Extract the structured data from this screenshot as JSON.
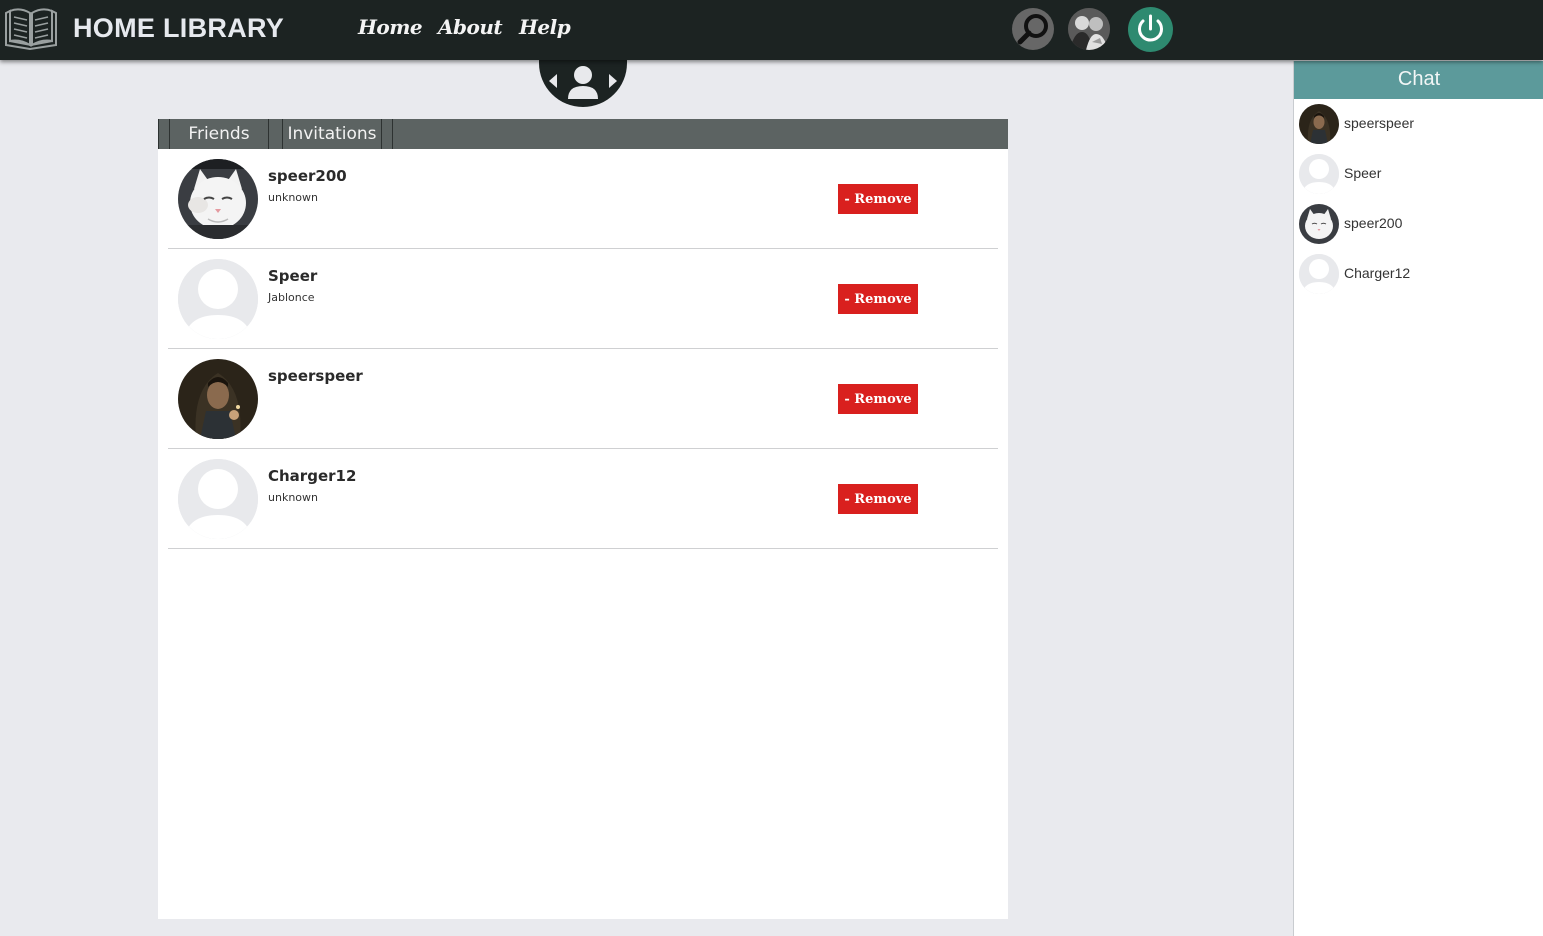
{
  "header": {
    "app_title": "HOME LIBRARY",
    "nav": [
      {
        "label": "Home"
      },
      {
        "label": "About"
      },
      {
        "label": "Help"
      }
    ],
    "icons": [
      "book-logo-icon",
      "search-icon",
      "user-avatar",
      "power-icon"
    ]
  },
  "tabs": [
    {
      "label": "Friends"
    },
    {
      "label": "Invitations"
    }
  ],
  "friends": [
    {
      "name": "speer200",
      "subtitle": "unknown",
      "avatar": "kitten-photo",
      "button": "- Remove"
    },
    {
      "name": "Speer",
      "subtitle": "Jablonce",
      "avatar": "default-avatar",
      "button": "- Remove"
    },
    {
      "name": "speerspeer",
      "subtitle": "",
      "avatar": "hooded-figure-photo",
      "button": "- Remove"
    },
    {
      "name": "Charger12",
      "subtitle": "unknown",
      "avatar": "default-avatar",
      "button": "- Remove"
    }
  ],
  "chat": {
    "title": "Chat",
    "users": [
      {
        "name": "speerspeer",
        "avatar": "hooded-figure-photo"
      },
      {
        "name": "Speer",
        "avatar": "default-avatar"
      },
      {
        "name": "speer200",
        "avatar": "kitten-photo"
      },
      {
        "name": "Charger12",
        "avatar": "default-avatar"
      }
    ]
  },
  "colors": {
    "topbar": "#1c2322",
    "remove_button": "#d9201e",
    "chat_header": "#5c9a9b",
    "power_button": "#2e8a70",
    "tabs_bar": "#5c6362"
  }
}
